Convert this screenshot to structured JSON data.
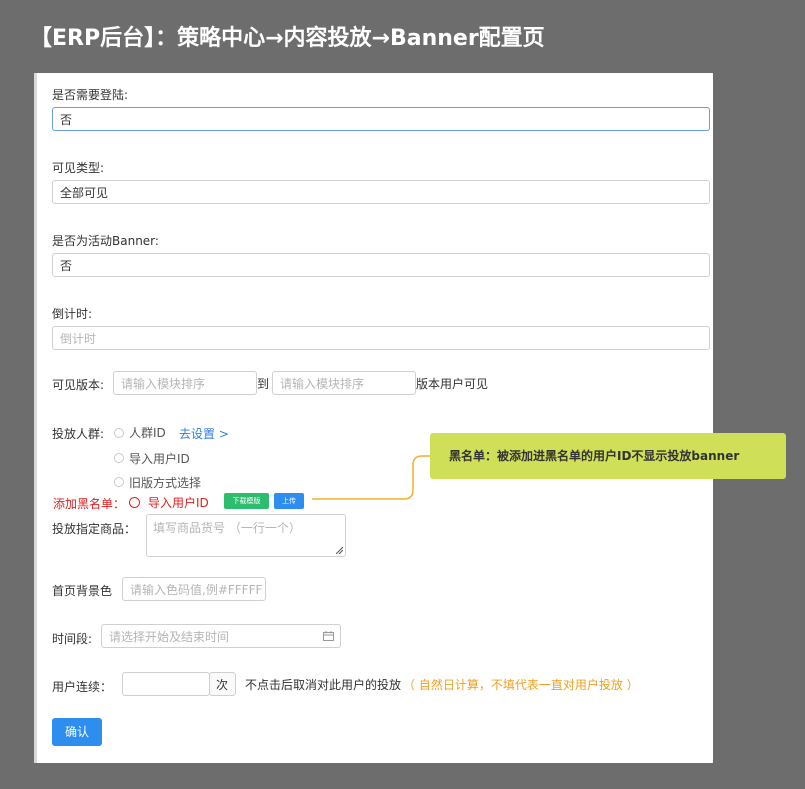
{
  "page_title": "【ERP后台】：策略中心→内容投放→Banner配置页",
  "form": {
    "login_required": {
      "label": "是否需要登陆:",
      "value": "否"
    },
    "visible_type": {
      "label": "可见类型:",
      "value": "全部可见"
    },
    "is_activity": {
      "label": "是否为活动Banner:",
      "value": "否"
    },
    "countdown": {
      "label": "倒计时:",
      "placeholder": "倒计时"
    },
    "visible_version": {
      "label": "可见版本:",
      "from_placeholder": "请输入模块排序",
      "to_text": "到",
      "to_placeholder": "请输入模块排序",
      "suffix": "版本用户可见"
    },
    "audience": {
      "label": "投放人群:",
      "options": [
        "人群ID",
        "导入用户ID",
        "旧版方式选择"
      ],
      "settings_link": "去设置 >"
    },
    "blacklist": {
      "label": "添加黑名单：",
      "option": "导入用户ID",
      "download_template": "下载模版",
      "upload": "上传"
    },
    "products": {
      "label": "投放指定商品：",
      "placeholder": "填写商品货号 （一行一个）"
    },
    "background": {
      "label": "首页背景色",
      "placeholder": "请输入色码值,例#FFFFF"
    },
    "time_range": {
      "label": "时间段:",
      "placeholder": "请选择开始及结束时间"
    },
    "consecutive": {
      "label": "用户连续：",
      "unit": "次",
      "hint": "不点击后取消对此用户的投放",
      "note": "（ 自然日计算，不填代表一直对用户投放 ）"
    },
    "confirm_button": "确认"
  },
  "callout": "黑名单：被添加进黑名单的用户ID不显示投放banner",
  "colors": {
    "background": "#6d6d6d",
    "primary": "#2d8ef0",
    "danger": "#e02020",
    "success": "#2dbd6e",
    "warning": "#f0a020",
    "callout": "#cfe058"
  }
}
